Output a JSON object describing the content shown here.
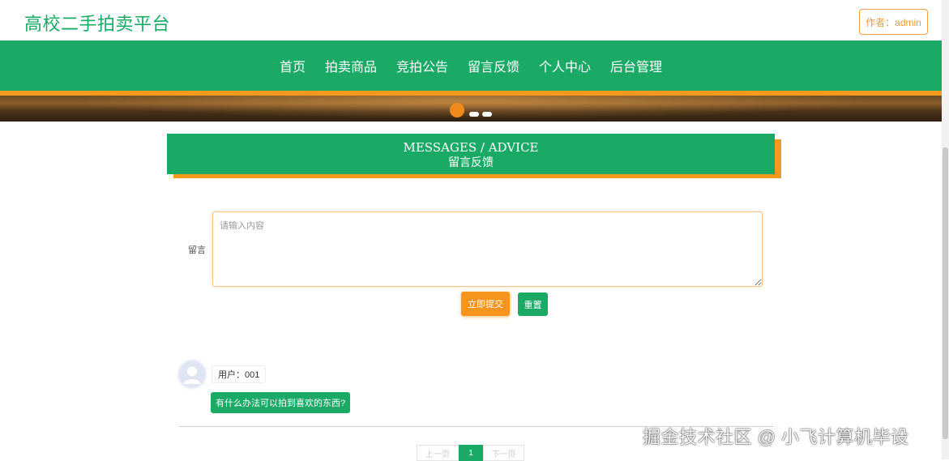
{
  "header": {
    "site_title": "高校二手拍卖平台",
    "author_label": "作者：admin"
  },
  "nav": {
    "items": [
      {
        "label": "首页"
      },
      {
        "label": "拍卖商品"
      },
      {
        "label": "竞拍公告"
      },
      {
        "label": "留言反馈"
      },
      {
        "label": "个人中心"
      },
      {
        "label": "后台管理"
      }
    ]
  },
  "banner": {
    "slide_count": 3,
    "active_slide": 1
  },
  "section": {
    "title_en": "MESSAGES / ADVICE",
    "title_cn": "留言反馈"
  },
  "form": {
    "label": "留言",
    "placeholder": "请输入内容",
    "value": "",
    "submit_label": "立即提交",
    "reset_label": "重置"
  },
  "comments": [
    {
      "user": "用户：001",
      "content": "有什么办法可以拍到喜欢的东西?"
    }
  ],
  "pagination": {
    "prev_label": "上一页",
    "current_page": "1",
    "next_label": "下一页"
  },
  "watermark": "掘金技术社区 @ 小飞计算机毕设",
  "colors": {
    "primary_green": "#1aaa66",
    "accent_orange": "#f39a1c"
  }
}
